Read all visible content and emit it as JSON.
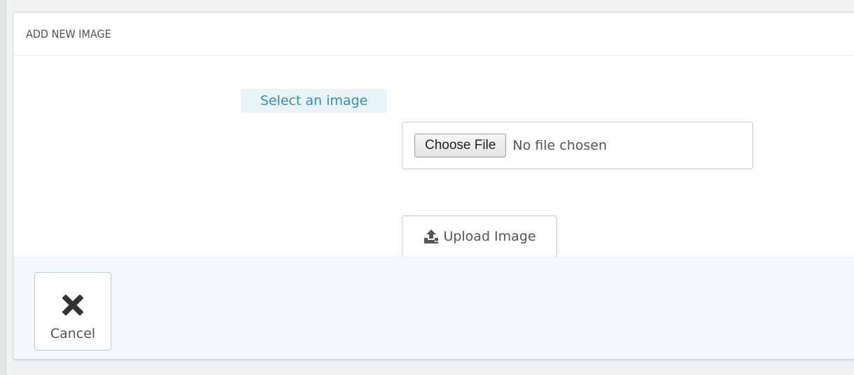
{
  "panel": {
    "title": "ADD NEW IMAGE"
  },
  "form": {
    "select_label": "Select an image",
    "choose_file_label": "Choose File",
    "file_status": "No file chosen",
    "upload_label": "Upload Image"
  },
  "footer": {
    "cancel_label": "Cancel"
  },
  "colors": {
    "label_text": "#3a8eb3",
    "label_bg": "#e8f4f8",
    "border": "#bbcdd2",
    "footer_bg": "#f5f8fa"
  },
  "icons": {
    "upload": "upload-icon",
    "cancel": "close-icon"
  }
}
